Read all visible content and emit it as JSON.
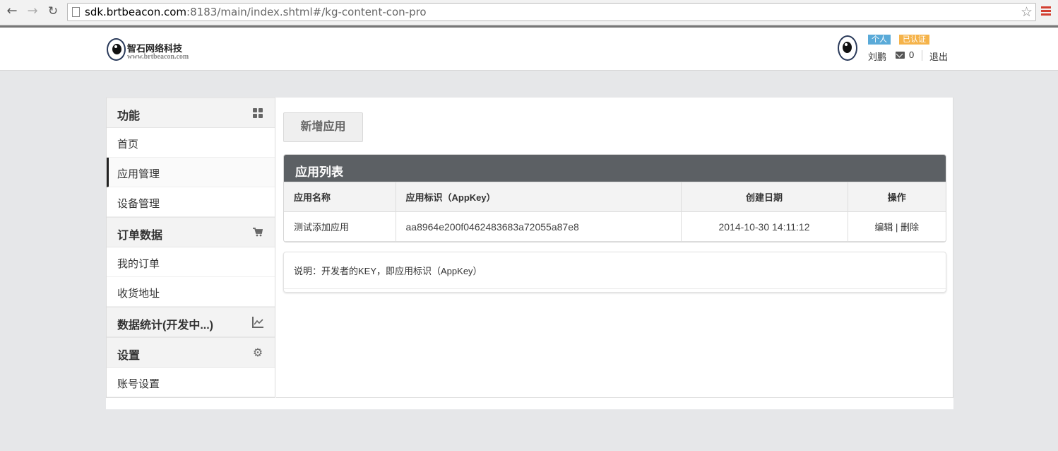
{
  "browser": {
    "url_host": "sdk.brtbeacon.com",
    "url_rest": ":8183/main/index.shtml#/kg-content-con-pro"
  },
  "header": {
    "logo_name": "智石网络科技",
    "logo_url": "www.brtbeacon.com",
    "badge_personal": "个人",
    "badge_verified": "已认证",
    "username": "刘鹏",
    "mail_count": "0",
    "logout": "退出"
  },
  "sidebar": {
    "sections": [
      {
        "title": "功能",
        "icon": "grid-icon"
      },
      {
        "title": "订单数据",
        "icon": "cart-icon"
      },
      {
        "title": "数据统计(开发中...)",
        "icon": "chart-icon"
      },
      {
        "title": "设置",
        "icon": "gear-icon"
      }
    ],
    "items": [
      {
        "label": "首页"
      },
      {
        "label": "应用管理",
        "active": true
      },
      {
        "label": "设备管理"
      },
      {
        "label": "我的订单"
      },
      {
        "label": "收货地址"
      },
      {
        "label": "账号设置"
      }
    ]
  },
  "main": {
    "add_button": "新增应用",
    "panel_title": "应用列表",
    "columns": [
      "应用名称",
      "应用标识（AppKey）",
      "创建日期",
      "操作"
    ],
    "rows": [
      {
        "name": "测试添加应用",
        "appkey": "aa8964e200f0462483683a72055a87e8",
        "created": "2014-10-30 14:11:12",
        "edit": "编辑",
        "divider": "|",
        "delete": "删除"
      }
    ],
    "note": "说明：开发者的KEY，即应用标识（AppKey）"
  },
  "colors": {
    "panel_head": "#5c6064",
    "badge_personal": "#5aaad8",
    "badge_verified": "#f5b34a",
    "page_bg": "#e6e7e9"
  }
}
